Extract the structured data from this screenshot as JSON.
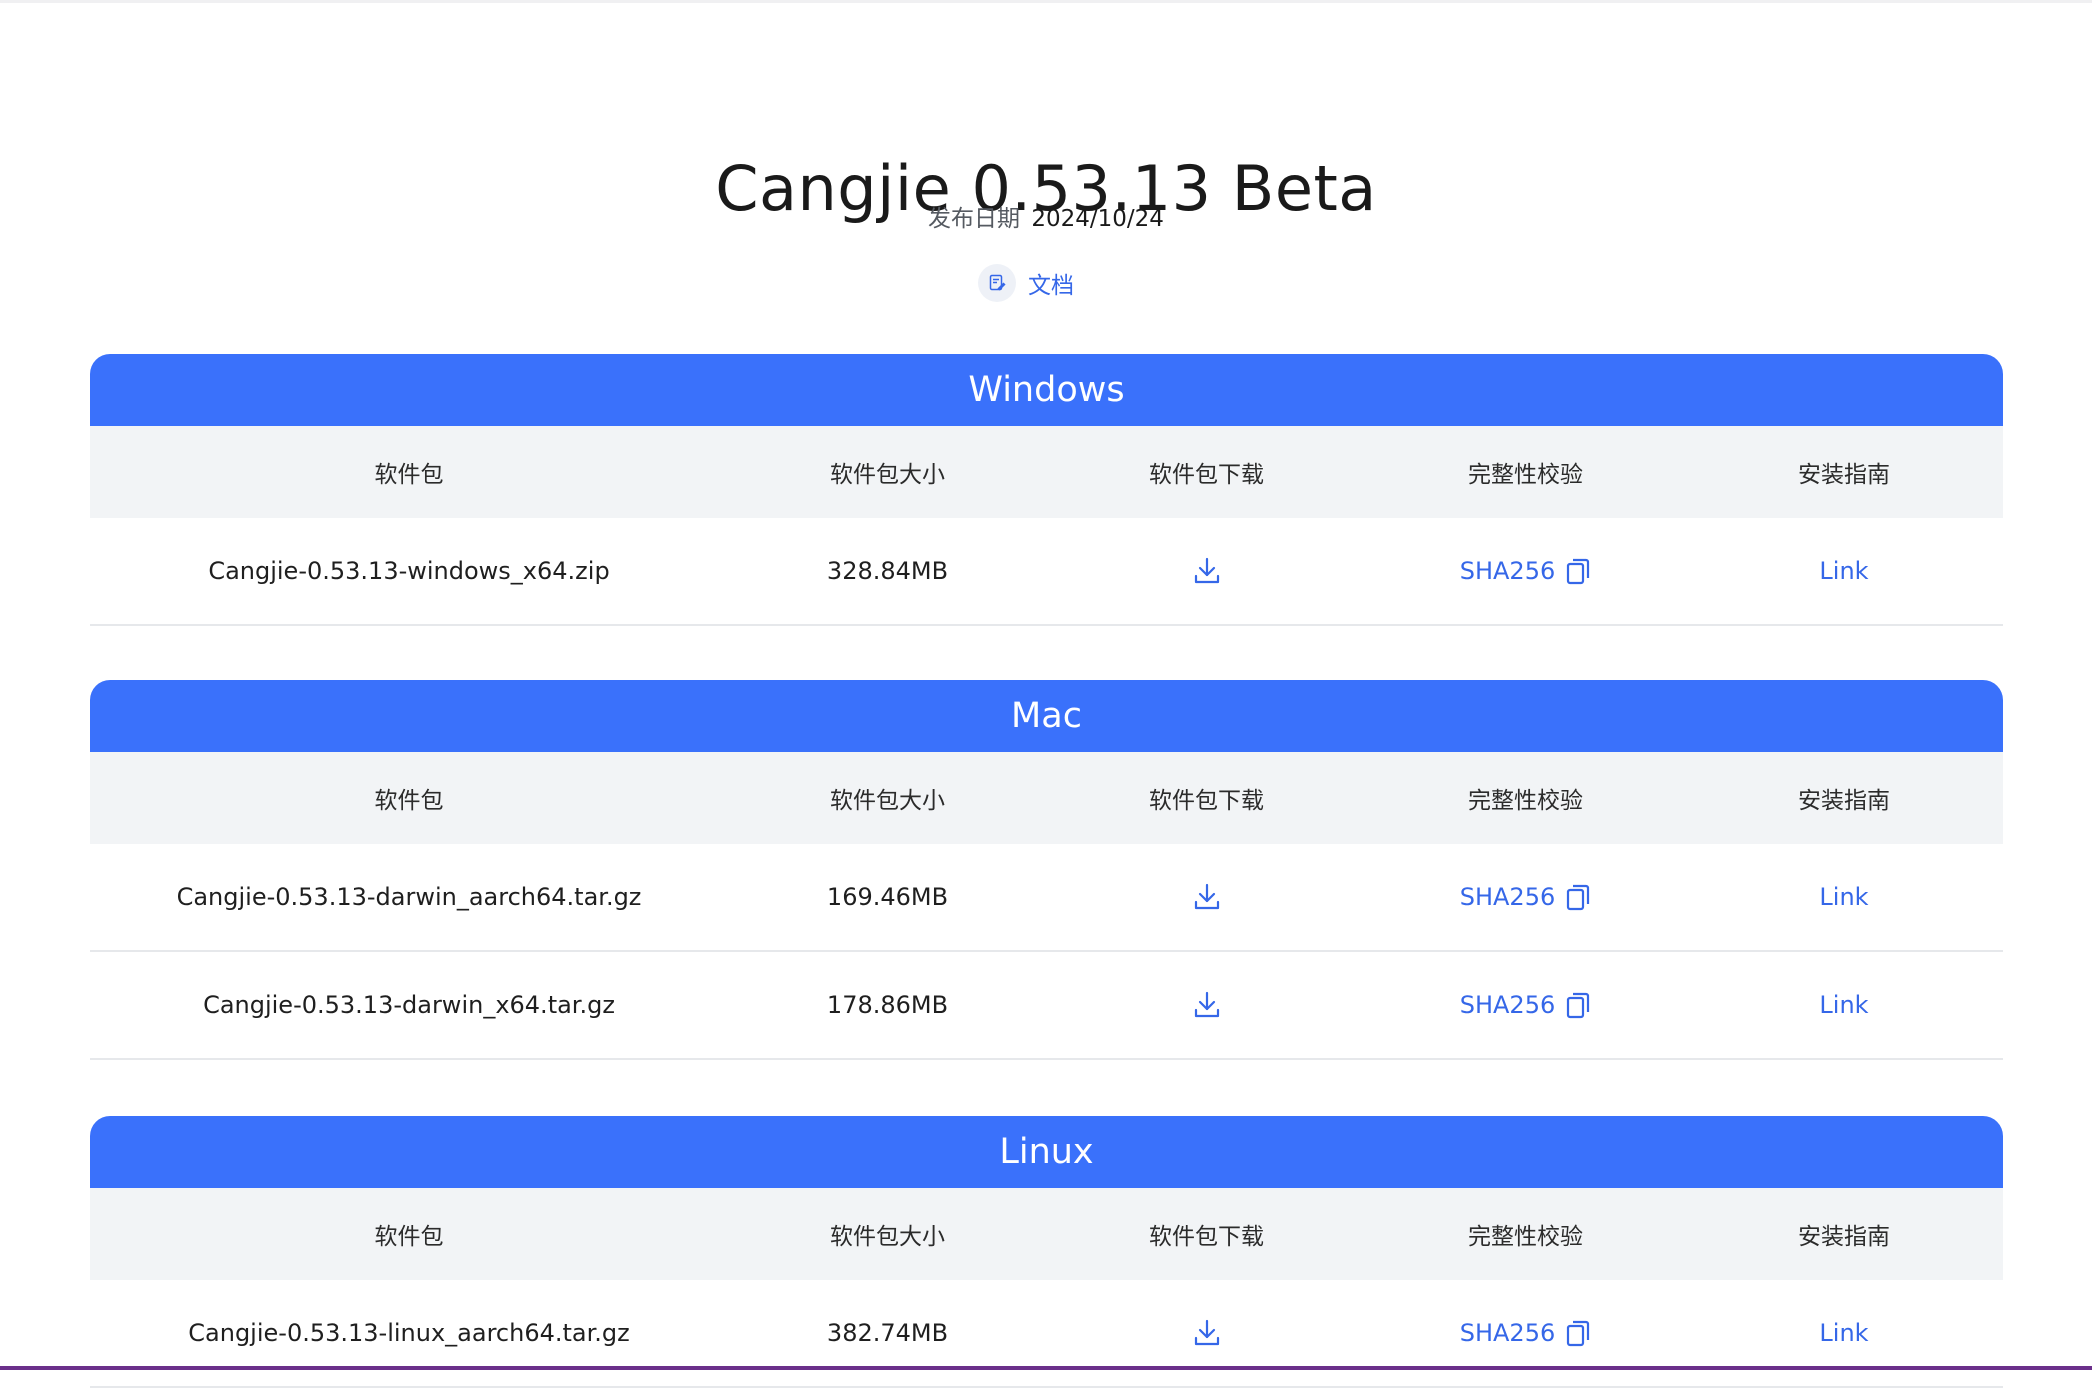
{
  "page": {
    "title": "Cangjie 0.53.13 Beta",
    "release_label": "发布日期",
    "release_date": "2024/10/24",
    "docs_label": "文档"
  },
  "columns": [
    "软件包",
    "软件包大小",
    "软件包下载",
    "完整性校验",
    "安装指南"
  ],
  "sections": [
    {
      "name": "Windows",
      "rows": [
        {
          "package": "Cangjie-0.53.13-windows_x64.zip",
          "size": "328.84MB",
          "checksum": "SHA256",
          "guide": "Link"
        }
      ]
    },
    {
      "name": "Mac",
      "rows": [
        {
          "package": "Cangjie-0.53.13-darwin_aarch64.tar.gz",
          "size": "169.46MB",
          "checksum": "SHA256",
          "guide": "Link"
        },
        {
          "package": "Cangjie-0.53.13-darwin_x64.tar.gz",
          "size": "178.86MB",
          "checksum": "SHA256",
          "guide": "Link"
        }
      ]
    },
    {
      "name": "Linux",
      "rows": [
        {
          "package": "Cangjie-0.53.13-linux_aarch64.tar.gz",
          "size": "382.74MB",
          "checksum": "SHA256",
          "guide": "Link"
        }
      ]
    }
  ],
  "icons": {
    "docs": "document-icon",
    "download": "download-icon",
    "copy": "copy-icon"
  },
  "colors": {
    "accent": "#3a71fb",
    "link": "#3567e8",
    "header_bg": "#f2f4f6"
  }
}
